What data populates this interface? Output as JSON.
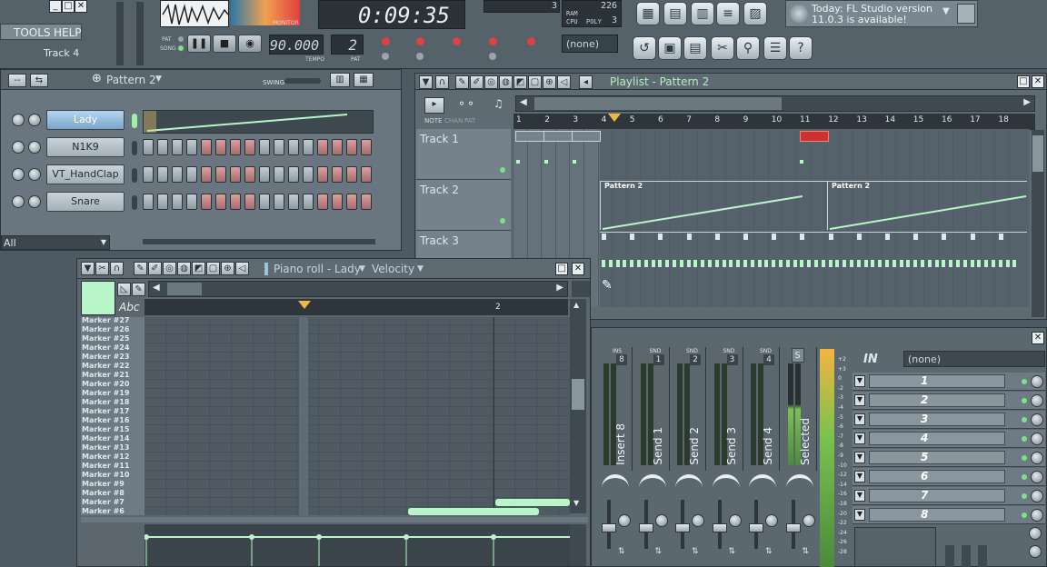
{
  "top": {
    "menu": {
      "tools": "TOOLS",
      "help": "HELP"
    },
    "track_hint": "Track 4",
    "monitor_label": "MONITOR",
    "time": "0:09:35",
    "pat_label": "PAT",
    "song_label": "SONG",
    "tempo": "90.000",
    "pattern_num": "2",
    "tempo_label": "TEMPO",
    "pat_label2": "PAT",
    "cpu_label": "CPU",
    "poly_label": "POLY",
    "ram_label": "RAM",
    "cpu_value": "226",
    "ram_value": "3",
    "poly_value": "3",
    "none_select": "(none)",
    "hint_line1": "Today: FL Studio version",
    "hint_line2": "11.0.3 is available!"
  },
  "step_seq": {
    "pattern": "Pattern 2",
    "swing_label": "SWING",
    "channels": [
      "Lady",
      "N1K9",
      "VT_HandClap",
      "Snare"
    ],
    "filter": "All"
  },
  "playlist": {
    "title": "Playlist - Pattern 2",
    "tabs": [
      "NOTE",
      "CHAN",
      "PAT"
    ],
    "ruler": [
      "1",
      "2",
      "3",
      "4",
      "5",
      "6",
      "7",
      "8",
      "9",
      "10",
      "11",
      "12",
      "13",
      "14",
      "15",
      "16",
      "17",
      "18"
    ],
    "tracks": [
      "Track 1",
      "Track 2",
      "Track 3"
    ],
    "clip_label": "Pattern 2"
  },
  "piano_roll": {
    "title": "Piano roll - Lady",
    "velocity": "Velocity",
    "abc": "Abc",
    "bar2": "2",
    "markers": [
      "Marker #27",
      "Marker #26",
      "Marker #25",
      "Marker #24",
      "Marker #23",
      "Marker #22",
      "Marker #21",
      "Marker #20",
      "Marker #19",
      "Marker #18",
      "Marker #17",
      "Marker #16",
      "Marker #15",
      "Marker #14",
      "Marker #13",
      "Marker #12",
      "Marker #11",
      "Marker #10",
      "Marker #9",
      "Marker #8",
      "Marker #7",
      "Marker #6"
    ]
  },
  "mixer": {
    "strips": [
      {
        "tag": "INS",
        "num": "8",
        "name": "Insert 8"
      },
      {
        "tag": "SND",
        "num": "1",
        "name": "Send 1"
      },
      {
        "tag": "SND",
        "num": "2",
        "name": "Send 2"
      },
      {
        "tag": "SND",
        "num": "3",
        "name": "Send 3"
      },
      {
        "tag": "SND",
        "num": "4",
        "name": "Send 4"
      },
      {
        "tag": "S",
        "num": "",
        "name": "Selected"
      }
    ],
    "in_label": "IN",
    "in_select": "(none)",
    "insert_slots": [
      "1",
      "2",
      "3",
      "4",
      "5",
      "6",
      "7",
      "8"
    ],
    "db_scale": [
      "+2",
      "+3",
      "0",
      "-2",
      "-3",
      "-4",
      "-5",
      "-6",
      "-7",
      "-8",
      "-9",
      "-10",
      "-12",
      "-14",
      "-16",
      "-18",
      "-20",
      "-22",
      "-24",
      "-26",
      "-28"
    ]
  },
  "colors": {
    "accent_green": "#b8f5c8",
    "clip_red": "#d03030",
    "bg": "#4e5a63"
  }
}
